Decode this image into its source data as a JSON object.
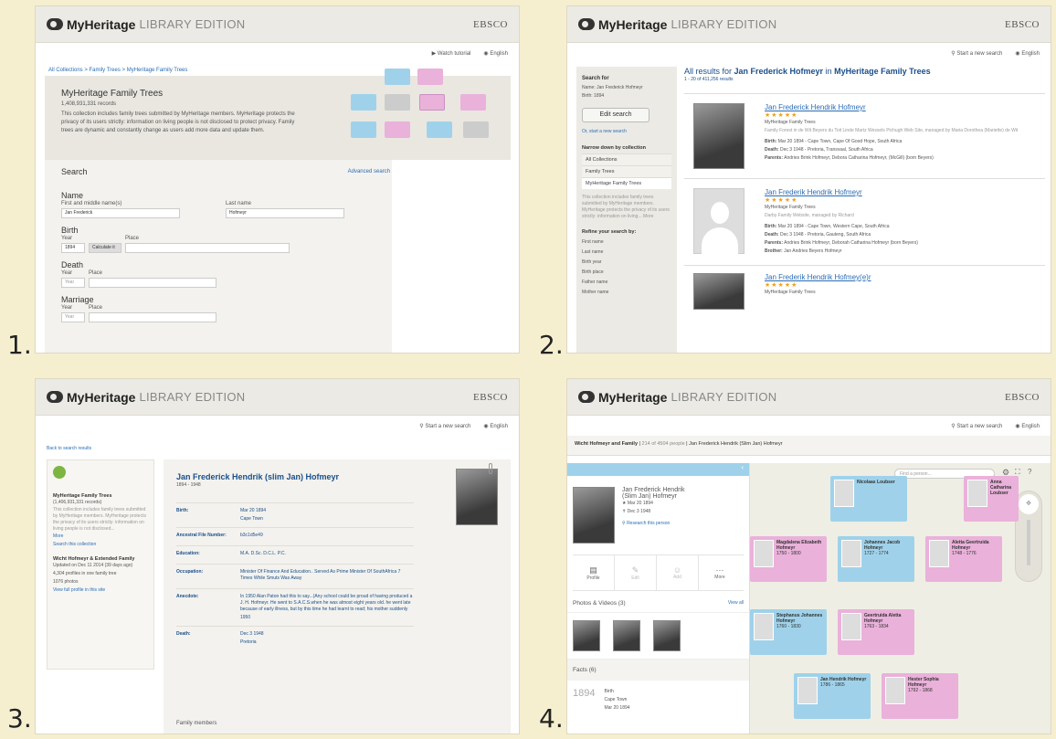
{
  "labels": {
    "p1": "1.",
    "p2": "2.",
    "p3": "3.",
    "p4": "4."
  },
  "header": {
    "brand": "MyHeritage",
    "edition": "LIBRARY EDITION",
    "ebsco": "EBSCO"
  },
  "p1": {
    "watch": "Watch tutorial",
    "lang": "English",
    "crumbs": "All Collections > Family Trees > MyHeritage Family Trees",
    "title": "MyHeritage Family Trees",
    "records": "1,408,931,331 records",
    "desc": "This collection includes family trees submitted by MyHeritage members. MyHeritage protects the privacy of its users strictly: information on living people is not disclosed to protect privacy. Family trees are dynamic and constantly change as users add more data and update them.",
    "search": "Search",
    "advanced": "Advanced search",
    "name": "Name",
    "first": "First and middle name(s)",
    "last": "Last name",
    "first_val": "Jan Frederick",
    "last_val": "Hofmeyr",
    "birth": "Birth",
    "year": "Year",
    "place": "Place",
    "birth_year": "1894",
    "calc": "Calculate it",
    "death": "Death",
    "marriage": "Marriage",
    "year_ph": "Year"
  },
  "p2": {
    "start": "Start a new search",
    "lang": "English",
    "searchfor": "Search for",
    "sf_name": "Name:  Jan Frederick Hofmeyr",
    "sf_birth": "Birth:  1894",
    "edit": "Edit search",
    "or_start": "Or, start a new search",
    "narrow": "Narrow down by collection",
    "coll": [
      "All Collections",
      "Family Trees",
      "MyHeritage Family Trees"
    ],
    "note": "This collection includes family trees submitted by MyHeritage members. MyHeritage protects the privacy of its users strictly: information on living... More",
    "refine": "Refine your search by:",
    "refine_items": [
      "First name",
      "Last name",
      "Birth year",
      "Birth place",
      "Father name",
      "Mother name"
    ],
    "results_pre": "All results for ",
    "results_name": "Jan Frederick Hofmeyr",
    "results_in": " in ",
    "results_coll": "MyHeritage Family Trees",
    "count": "1 - 20 of 411,256 results",
    "r1": {
      "name": "Jan Frederick Hendrik Hofmeyr",
      "src": "MyHeritage Family Trees",
      "site": "Family Forest in de Wit Beyers du Toit Linde Martz Wessels Pichugh Web Site, managed by Maria Dorothea (Mariette) de Wit",
      "birth_l": "Birth:",
      "birth": "Mar 20 1894 - Cape Town, Cape Of Good Hope, South Africa",
      "death_l": "Death:",
      "death": "Dec 3 1948 - Pretoria, Transvaal, South Africa",
      "par_l": "Parents:",
      "par": "Andries Brink Hofmeyr, Debora Catharina Hofmeyr, (McGill) (born Beyers)"
    },
    "r2": {
      "name": "Jan Frederik Hendrik Hofmeyr",
      "src": "MyHeritage Family Trees",
      "site": "Darby Family Website, managed by Richard",
      "birth_l": "Birth:",
      "birth": "Mar 20 1894 - Cape Town, Western Cape, South Africa",
      "death_l": "Death:",
      "death": "Dec 3 1948 - Pretoria, Gauteng, South Africa",
      "par_l": "Parents:",
      "par": "Andries Brink Hofmeyr, Deborah Catharina Hofmeyr (born Beyers)",
      "bro_l": "Brother:",
      "bro": "Jan Andries Beyers Hofmeyr"
    },
    "r3": {
      "name": "Jan Frederik Hendrik Hofmey(e)r",
      "src": "MyHeritage Family Trees"
    }
  },
  "p3": {
    "start": "Start a new search",
    "lang": "English",
    "back": "Back to search results",
    "coll": "MyHeritage Family Trees",
    "coll_rec": "(1,406,931,331 records)",
    "coll_desc": "This collection includes family trees submitted by MyHeritage members. MyHeritage protects the privacy of its users strictly: information on living people is not disclosed...",
    "more": "More",
    "search_coll": "Search this collection",
    "tree": "Wicht Hofmeyr & Extended Family",
    "updated": "Updated on Dec 11 2014 (39 days ago)",
    "profiles": "4,304 profiles in one family tree",
    "photos": "1076 photos",
    "view": "View full profile in this site",
    "name": "Jan Frederick Hendrik (slim Jan) Hofmeyr",
    "years": "1894 - 1948",
    "facts": [
      {
        "k": "Birth:",
        "v": "Mar 20 1894",
        "sub": "Cape Town"
      },
      {
        "k": "Ancestral File Number:",
        "v": "b3c1d5e49",
        "sub": ""
      },
      {
        "k": "Education:",
        "v": "M.A. D.Sc. D.C.L. P.C.",
        "sub": ""
      },
      {
        "k": "Occupation:",
        "v": "Minister Of Finance And Education.. Served As Prime Minister Of SouthAfrica 7 Times While Smuts Was Away",
        "sub": ""
      },
      {
        "k": "Anecdote:",
        "v": "In 1950 Alan Paton had this to say...(Any school could be proud of having produced a J. H. Hofmeyr. He went to S.A.C.S.when he was almost eight years old. he went late because of early illness, but by this time he had learnt to read; his mother suddenly",
        "sub": "1950"
      },
      {
        "k": "Death:",
        "v": "Dec 3 1948",
        "sub": "Pretoria"
      }
    ],
    "family": "Family members"
  },
  "p4": {
    "start": "Start a new search",
    "lang": "English",
    "tree": "Wicht Hofmeyr and Family",
    "people": "214 of 4504 people",
    "crumb_person": "Jan Frederick Hendrik (Slim Jan) Hofmeyr",
    "find": "Find a person...",
    "pname1": "Jan Frederick Hendrik",
    "pname2": "(Slim Jan) Hofmeyr",
    "pbirth": "Mar 20 1894",
    "pdeath": "Dec 3 1948",
    "research": "Research this person",
    "tools": [
      "Profile",
      "Edit",
      "Add",
      "More"
    ],
    "photos": "Photos & Videos (3)",
    "viewall": "View all",
    "facts": "Facts (6)",
    "fact_year": "1894",
    "fact_type": "Birth",
    "fact_place": "Cape Town",
    "fact_date": "Mar 20 1894",
    "nodes": [
      {
        "name": "Nicolaas Loubser",
        "years": "",
        "color": "#9fd2ea"
      },
      {
        "name": "Anna Catharina Loubser",
        "years": "",
        "color": "#eab1da"
      },
      {
        "name": "Magdalena Elizabeth Hofmeyr",
        "years": "1750 - 1800",
        "color": "#eab1da"
      },
      {
        "name": "Johannes Jacob Hofmeyr",
        "years": "1727 - 1774",
        "color": "#9fd2ea"
      },
      {
        "name": "Aletta Geertruida Hofmeyr",
        "years": "1748 - 1776",
        "color": "#eab1da"
      },
      {
        "name": "Stephanus Johannes Hofmeyr",
        "years": "1760 - 1830",
        "color": "#9fd2ea"
      },
      {
        "name": "Geertruida Aletta Hofmeyr",
        "years": "1763 - 1834",
        "color": "#eab1da"
      },
      {
        "name": "Jan Hendrik Hofmeyr",
        "years": "1786 - 1865",
        "color": "#9fd2ea"
      },
      {
        "name": "Hester Sophia Hofmeyr",
        "years": "1792 - 1868",
        "color": "#eab1da"
      }
    ]
  }
}
